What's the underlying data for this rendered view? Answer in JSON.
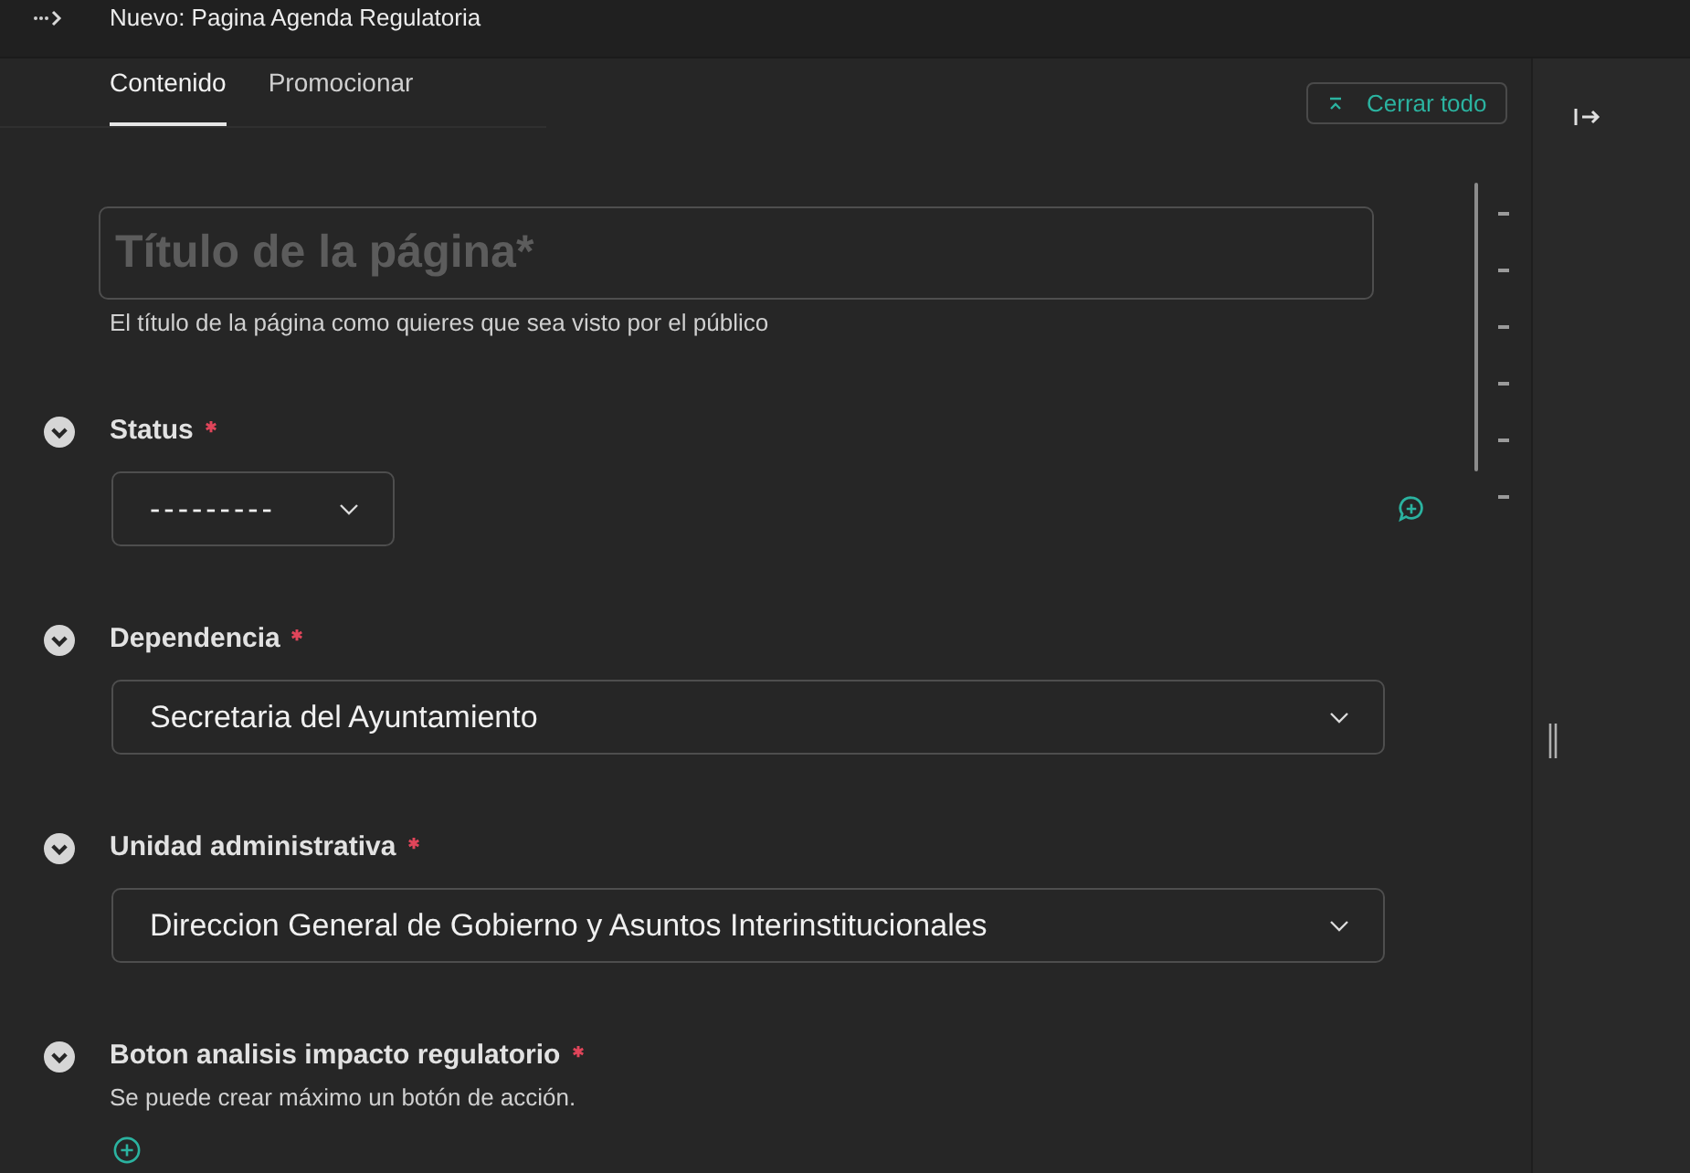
{
  "window": {
    "title": "Nuevo: Pagina Agenda Regulatoria"
  },
  "tabs": [
    {
      "label": "Contenido",
      "selected": true
    },
    {
      "label": "Promocionar",
      "selected": false
    }
  ],
  "toolbar": {
    "collapse_all": "Cerrar todo"
  },
  "title_field": {
    "placeholder": "Título de la página*",
    "help": "El título de la página como quieres que sea visto por el público"
  },
  "panels": [
    {
      "kind": "choice",
      "label": "Status",
      "required": true,
      "expanded": true,
      "value": "---------",
      "comment_button": true
    },
    {
      "kind": "chooser",
      "label": "Dependencia",
      "required": true,
      "expanded": true,
      "value": "Secretaria del Ayuntamiento",
      "comment_button": false
    },
    {
      "kind": "chooser",
      "label": "Unidad administrativa",
      "required": true,
      "expanded": true,
      "value": "Direccion General de Gobierno y Asuntos Interinstitucionales",
      "comment_button": false
    },
    {
      "kind": "buttons",
      "label": "Boton analisis impacto regulatorio",
      "required": true,
      "expanded": true,
      "help": "Se puede crear máximo un botón de acción.",
      "comment_button": false
    }
  ]
}
